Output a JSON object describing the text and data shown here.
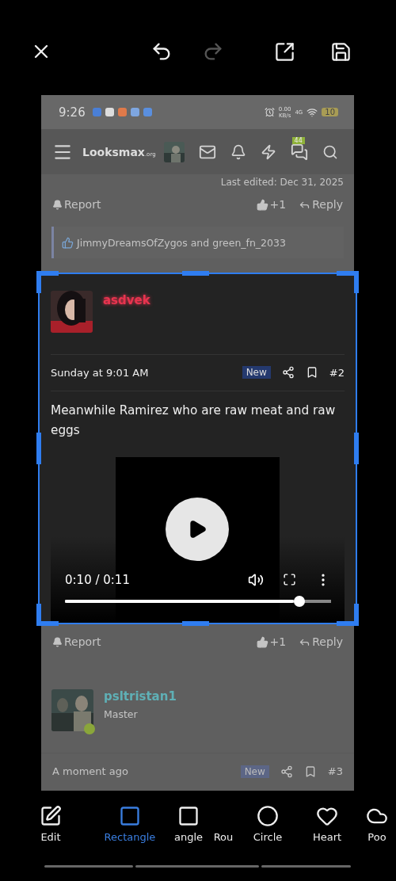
{
  "toolbar": {
    "redo_disabled": true
  },
  "status_bar": {
    "time": "9:26",
    "speed": "0.00",
    "speed_unit": "KB/s",
    "network": "4G",
    "battery": "10"
  },
  "nav": {
    "logo": "Looksmax",
    "logo_suffix": ".org",
    "chat_badge": "44"
  },
  "previous_post": {
    "last_edited": "Last edited: Dec 31, 2025",
    "report": "Report",
    "likes": "+1",
    "reply": "Reply",
    "reactions": "JimmyDreamsOfZygos and green_fn_2033"
  },
  "post": {
    "username": "asdvek",
    "date": "Sunday at 9:01 AM",
    "badge": "New",
    "number": "#2",
    "text": "Meanwhile Ramirez who are raw meat and raw eggs",
    "video": {
      "time": "0:10 / 0:11",
      "level": 0.88
    },
    "report": "Report",
    "likes": "+1",
    "reply": "Reply"
  },
  "next_post": {
    "username": "psltristan1",
    "role": "Master",
    "online": true,
    "date": "A moment ago",
    "badge": "New",
    "number": "#3"
  },
  "tools": [
    {
      "kind": "edit",
      "label": "Edit",
      "selected": false
    },
    {
      "kind": "rectangle",
      "label": "Rectangle",
      "selected": true
    },
    {
      "kind": "rounded",
      "label": "angle",
      "selected": false
    },
    {
      "kind": "text",
      "label": "Rou",
      "selected": false
    },
    {
      "kind": "circle",
      "label": "Circle",
      "selected": false
    },
    {
      "kind": "heart",
      "label": "Heart",
      "selected": false
    },
    {
      "kind": "cloud",
      "label": "Poo",
      "selected": false
    }
  ]
}
